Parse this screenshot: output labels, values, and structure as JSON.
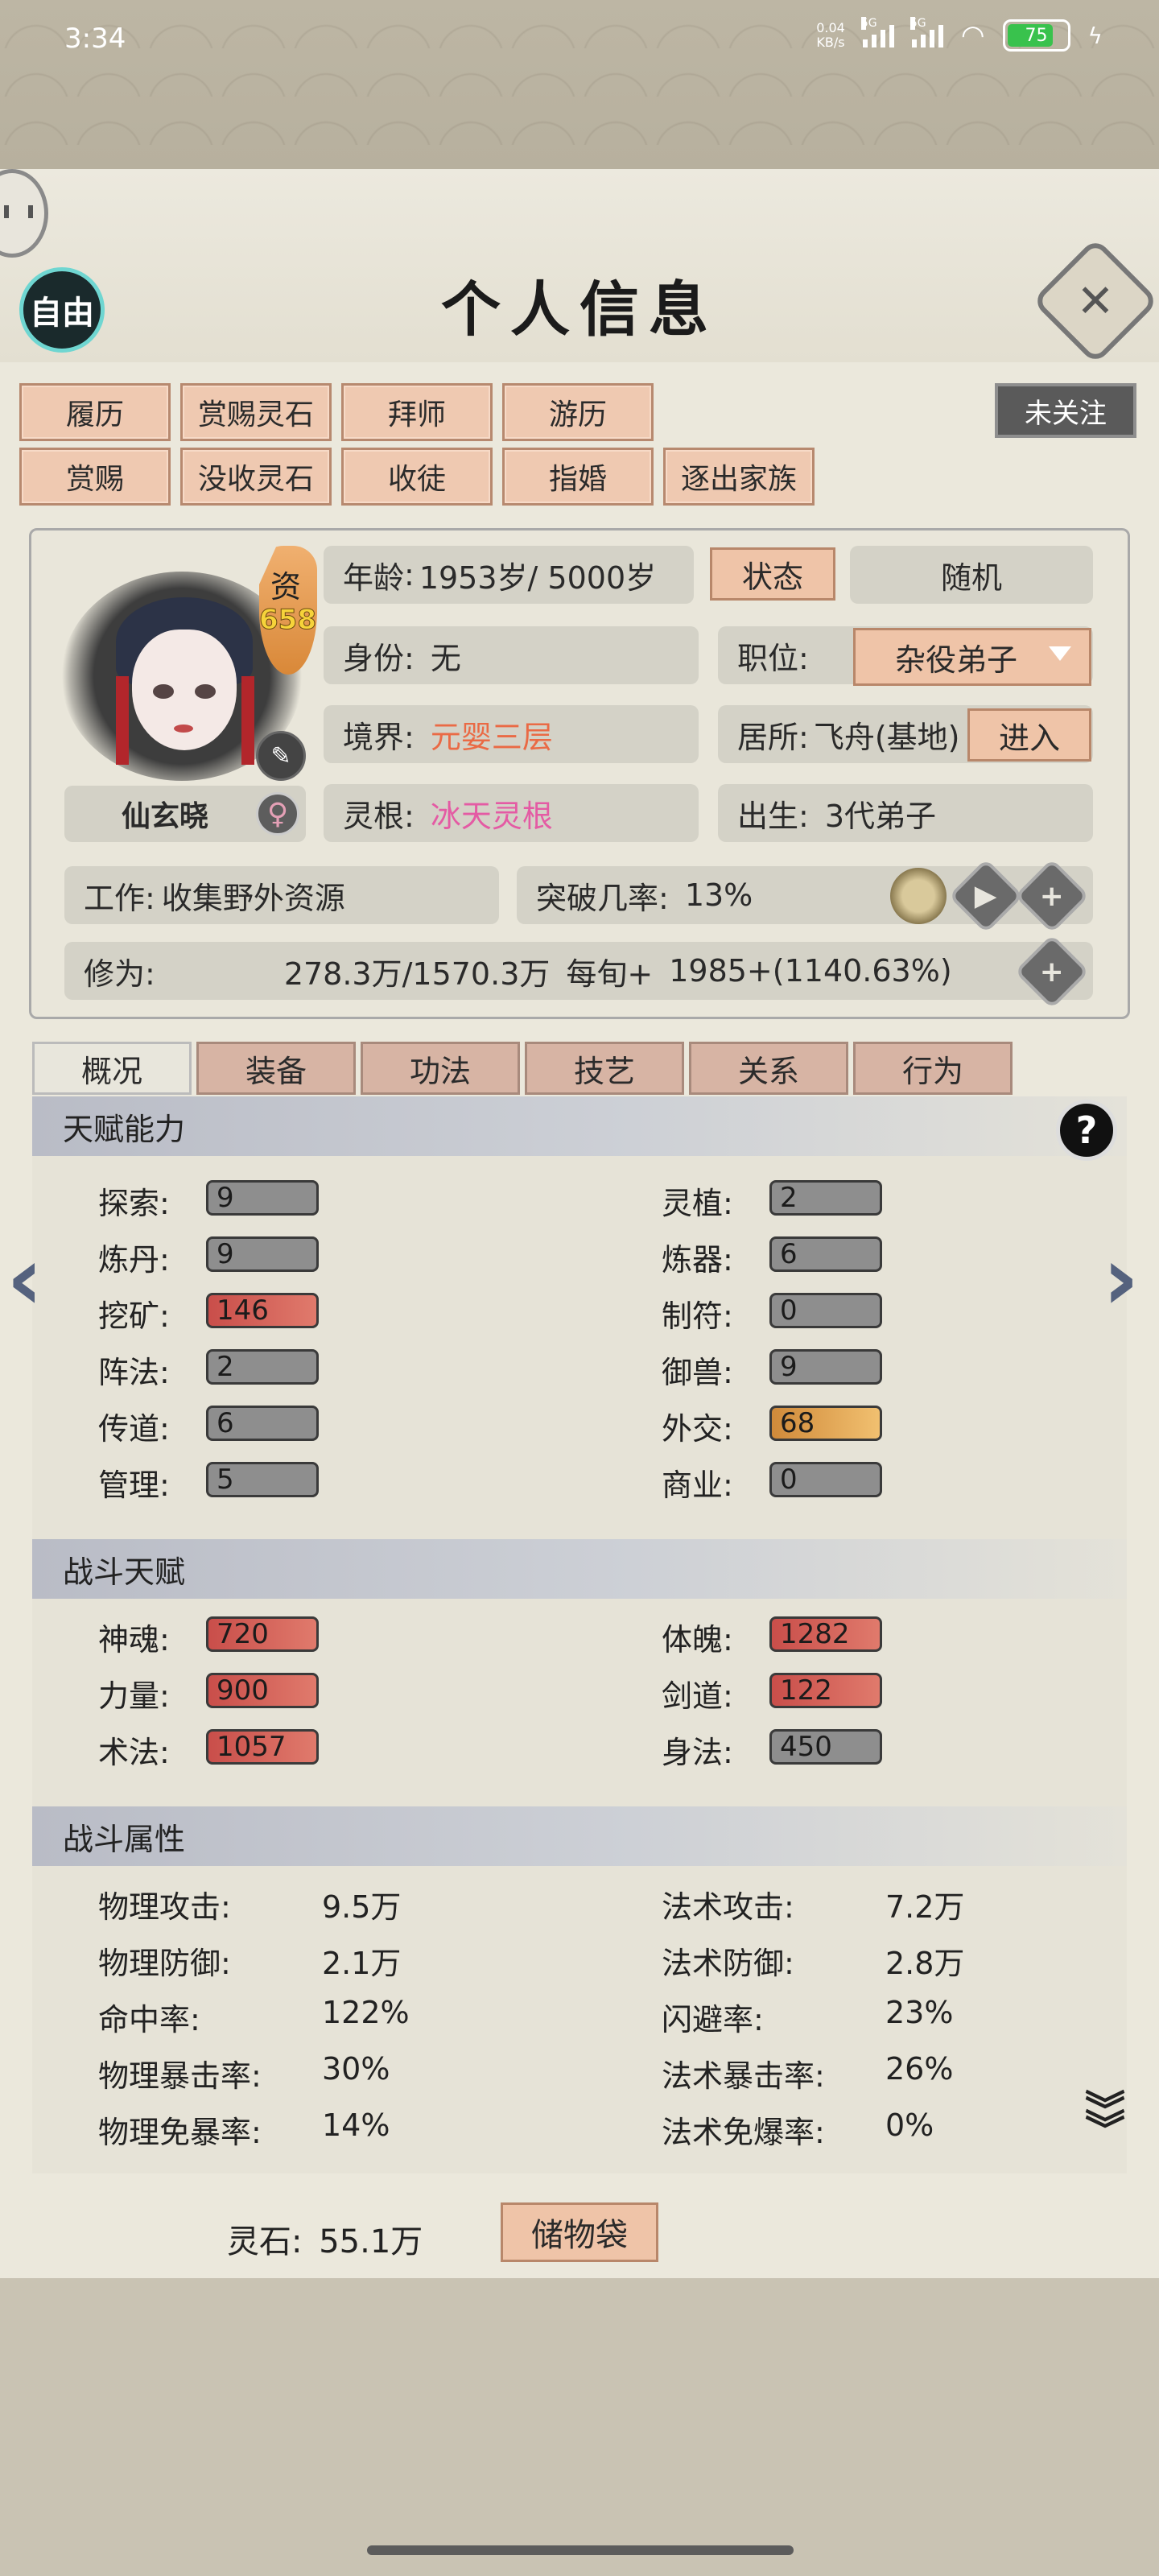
{
  "status_bar": {
    "time": "3:34",
    "net_speed_value": "0.04",
    "net_speed_unit": "KB/s",
    "sim1": "5G",
    "sim2": "5G",
    "battery": "75"
  },
  "header": {
    "title": "个人信息",
    "free_button": "自由",
    "close_icon": "close-icon"
  },
  "actions": {
    "row1": [
      "履历",
      "赏赐灵石",
      "拜师",
      "游历"
    ],
    "row2": [
      "赏赐",
      "没收灵石",
      "收徒",
      "指婚",
      "逐出家族"
    ],
    "follow": "未关注"
  },
  "profile": {
    "zi_label": "资",
    "zi_value": "658",
    "name": "仙玄晓",
    "gender_icon": "female-icon",
    "age_label": "年龄",
    "age_value": "1953岁/ 5000岁",
    "status_button": "状态",
    "random_button": "随机",
    "identity_label": "身份:",
    "identity_value": "无",
    "position_label": "职位:",
    "position_value": "杂役弟子",
    "realm_label": "境界:",
    "realm_value": "元婴三层",
    "residence_label": "居所:",
    "residence_value": "飞舟(基地)",
    "enter_button": "进入",
    "root_label": "灵根:",
    "root_value": "冰天灵根",
    "birth_label": "出生:",
    "birth_value": "3代弟子",
    "job_label": "工作:",
    "job_value": "收集野外资源",
    "breakthrough_label": "突破几率:",
    "breakthrough_value": "13%",
    "cultivation_label": "修为:",
    "cultivation_value": "278.3万/1570.3万",
    "per_turn_label": "每旬+",
    "per_turn_value": "1985+(1140.63%)"
  },
  "tabs": [
    "概况",
    "装备",
    "功法",
    "技艺",
    "关系",
    "行为"
  ],
  "active_tab": "概况",
  "talent": {
    "title": "天赋能力",
    "left": [
      {
        "label": "探索:",
        "value": "9",
        "tone": "gray"
      },
      {
        "label": "炼丹:",
        "value": "9",
        "tone": "gray"
      },
      {
        "label": "挖矿:",
        "value": "146",
        "tone": "red"
      },
      {
        "label": "阵法:",
        "value": "2",
        "tone": "gray"
      },
      {
        "label": "传道:",
        "value": "6",
        "tone": "gray"
      },
      {
        "label": "管理:",
        "value": "5",
        "tone": "gray"
      }
    ],
    "right": [
      {
        "label": "灵植:",
        "value": "2",
        "tone": "gray"
      },
      {
        "label": "炼器:",
        "value": "6",
        "tone": "gray"
      },
      {
        "label": "制符:",
        "value": "0",
        "tone": "gray"
      },
      {
        "label": "御兽:",
        "value": "9",
        "tone": "gray"
      },
      {
        "label": "外交:",
        "value": "68",
        "tone": "orange"
      },
      {
        "label": "商业:",
        "value": "0",
        "tone": "gray"
      }
    ]
  },
  "combat_talent": {
    "title": "战斗天赋",
    "left": [
      {
        "label": "神魂:",
        "value": "720",
        "tone": "red"
      },
      {
        "label": "力量:",
        "value": "900",
        "tone": "red"
      },
      {
        "label": "术法:",
        "value": "1057",
        "tone": "red"
      }
    ],
    "right": [
      {
        "label": "体魄:",
        "value": "1282",
        "tone": "red"
      },
      {
        "label": "剑道:",
        "value": "122",
        "tone": "red"
      },
      {
        "label": "身法:",
        "value": "450",
        "tone": "gray"
      }
    ]
  },
  "combat_attr": {
    "title": "战斗属性",
    "left": [
      {
        "label": "物理攻击:",
        "value": "9.5万"
      },
      {
        "label": "物理防御:",
        "value": "2.1万"
      },
      {
        "label": "命中率:",
        "value": "122%"
      },
      {
        "label": "物理暴击率:",
        "value": "30%"
      },
      {
        "label": "物理免暴率:",
        "value": "14%"
      }
    ],
    "right": [
      {
        "label": "法术攻击:",
        "value": "7.2万"
      },
      {
        "label": "法术防御:",
        "value": "2.8万"
      },
      {
        "label": "闪避率:",
        "value": "23%"
      },
      {
        "label": "法术暴击率:",
        "value": "26%"
      },
      {
        "label": "法术免爆率:",
        "value": "0%"
      }
    ]
  },
  "bottom": {
    "lingshi_label": "灵石:",
    "lingshi_value": "55.1万",
    "bag_button": "储物袋"
  }
}
